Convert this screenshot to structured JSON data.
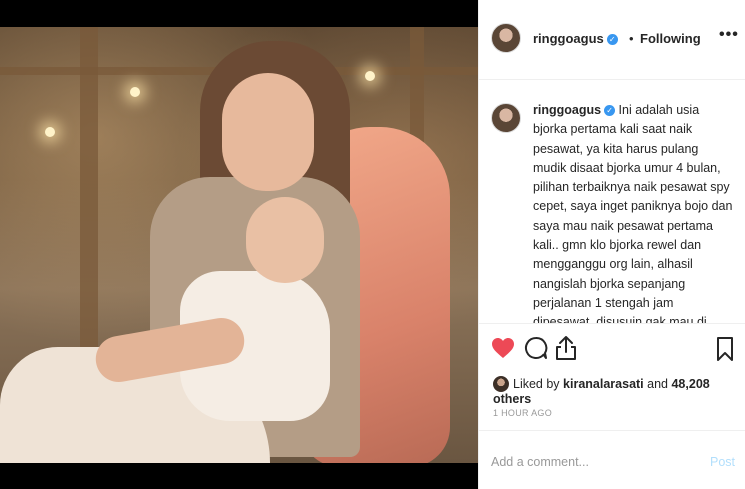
{
  "post": {
    "author": {
      "username": "ringgoagus",
      "verified": true,
      "follow_separator": "•",
      "follow_status": "Following"
    },
    "more_label": "•••",
    "caption": {
      "username": "ringgoagus",
      "text": "Ini adalah usia bjorka pertama kali saat naik pesawat, ya kita harus pulang mudik disaat bjorka umur 4 bulan, pilihan terbaiknya naik pesawat spy cepet, saya inget paniknya bojo dan saya mau naik pesawat pertama kali.. gmn klo bjorka rewel dan mengganggu org lain, alhasil nangislah bjorka sepanjang perjalanan 1 stengah jam dipesawat, disusuin gak mau di diemin jg gak"
    },
    "actions": {
      "like_icon": "heart-icon",
      "comment_icon": "comment-icon",
      "share_icon": "share-icon",
      "save_icon": "bookmark-icon",
      "liked": true,
      "like_color": "#ed4956"
    },
    "likes": {
      "prefix": "Liked by",
      "liker": "kiranalarasati",
      "connector": "and",
      "others": "48,208 others"
    },
    "timestamp": "1 HOUR AGO",
    "comment": {
      "placeholder": "Add a comment...",
      "post_label": "Post",
      "post_color": "#b2dffc"
    }
  }
}
